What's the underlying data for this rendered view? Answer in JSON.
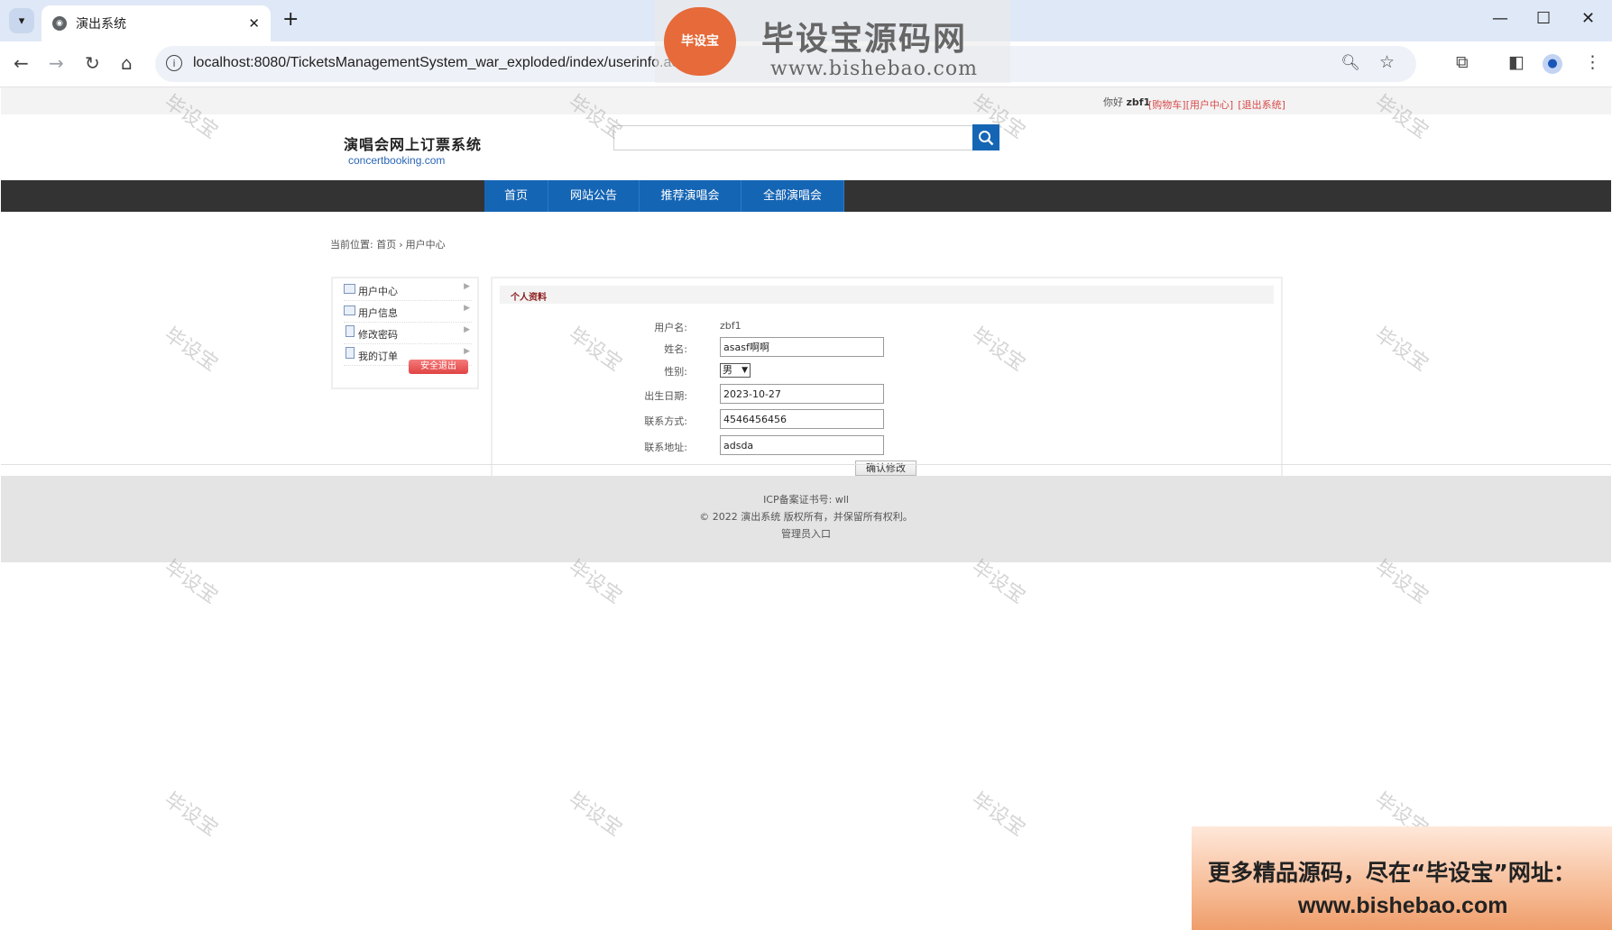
{
  "browser": {
    "tab_title": "演出系统",
    "url": "localhost:8080/TicketsManagementSystem_war_exploded/index/userinfo.action"
  },
  "topbar": {
    "greeting_prefix": "你好",
    "username": "zbf1",
    "link_cart": "[购物车]",
    "link_user_center": "[用户中心]",
    "link_logout": "[退出系统]"
  },
  "header": {
    "logo_cn": "演唱会网上订票系统",
    "logo_en": "concertbooking.com"
  },
  "nav": {
    "items": [
      "首页",
      "网站公告",
      "推荐演唱会",
      "全部演唱会"
    ]
  },
  "breadcrumb": {
    "label": "当前位置:",
    "home": "首页",
    "current": "用户中心"
  },
  "sidebar": {
    "items": [
      "用户中心",
      "用户信息",
      "修改密码",
      "我的订单"
    ],
    "logout": "安全退出"
  },
  "profile": {
    "title": "个人资料",
    "username_label": "用户名:",
    "username_value": "zbf1",
    "name_label": "姓名:",
    "name_value": "asasf啊啊",
    "gender_label": "性别:",
    "gender_value": "男",
    "birth_label": "出生日期:",
    "birth_value": "2023-10-27",
    "phone_label": "联系方式:",
    "phone_value": "4546456456",
    "address_label": "联系地址:",
    "address_value": "adsda",
    "submit": "确认修改"
  },
  "footer": {
    "icp": "ICP备案证书号: wll",
    "copyright": "© 2022 演出系统 版权所有，并保留所有权利。",
    "admin": "管理员入口"
  },
  "overlay": {
    "brand_seal": "毕设宝",
    "brand_name": "毕设宝源码网",
    "brand_url": "www.bishebao.com",
    "watermark": "毕设宝",
    "promo_line1": "更多精品源码，尽在“毕设宝”网址：",
    "promo_line2": "www.bishebao.com"
  }
}
